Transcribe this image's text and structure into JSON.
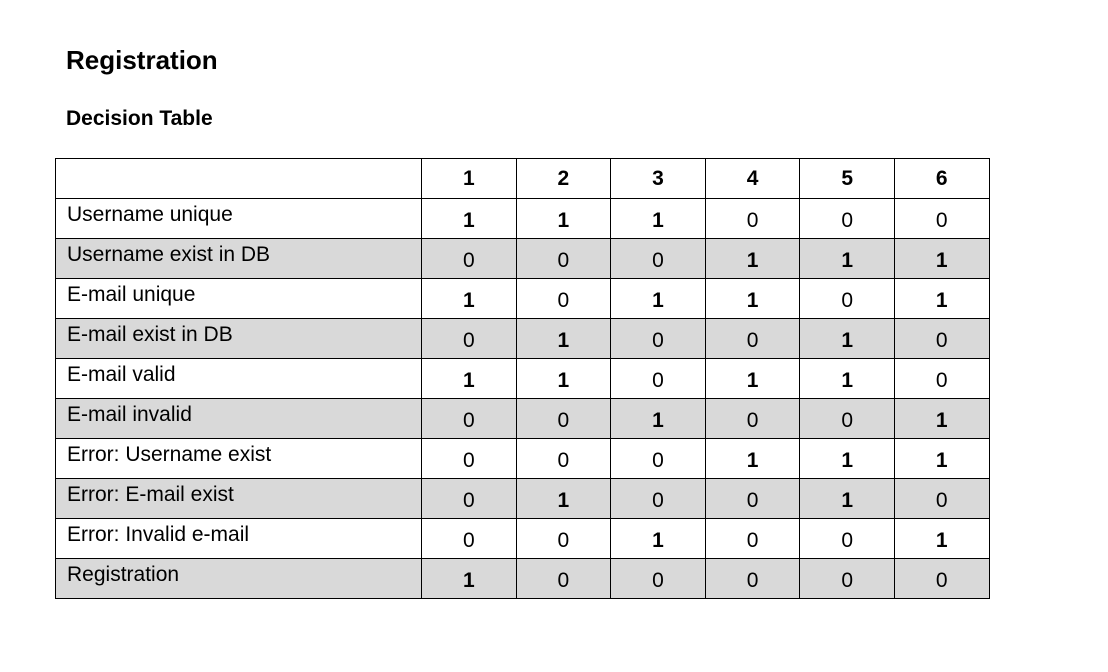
{
  "document": {
    "title": "Registration",
    "section": "Decision Table"
  },
  "table": {
    "columns": [
      "1",
      "2",
      "3",
      "4",
      "5",
      "6"
    ],
    "rows": [
      {
        "label": "Username unique",
        "values": [
          "1",
          "1",
          "1",
          "0",
          "0",
          "0"
        ],
        "shaded": false
      },
      {
        "label": "Username exist in DB",
        "values": [
          "0",
          "0",
          "0",
          "1",
          "1",
          "1"
        ],
        "shaded": true
      },
      {
        "label": "E-mail unique",
        "values": [
          "1",
          "0",
          "1",
          "1",
          "0",
          "1"
        ],
        "shaded": false
      },
      {
        "label": "E-mail exist in DB",
        "values": [
          "0",
          "1",
          "0",
          "0",
          "1",
          "0"
        ],
        "shaded": true
      },
      {
        "label": "E-mail valid",
        "values": [
          "1",
          "1",
          "0",
          "1",
          "1",
          "0"
        ],
        "shaded": false
      },
      {
        "label": "E-mail invalid",
        "values": [
          "0",
          "0",
          "1",
          "0",
          "0",
          "1"
        ],
        "shaded": true
      },
      {
        "label": "Error: Username exist",
        "values": [
          "0",
          "0",
          "0",
          "1",
          "1",
          "1"
        ],
        "shaded": false
      },
      {
        "label": "Error: E-mail exist",
        "values": [
          "0",
          "1",
          "0",
          "0",
          "1",
          "0"
        ],
        "shaded": true
      },
      {
        "label": "Error: Invalid e-mail",
        "values": [
          "0",
          "0",
          "1",
          "0",
          "0",
          "1"
        ],
        "shaded": false
      },
      {
        "label": "Registration",
        "values": [
          "1",
          "0",
          "0",
          "0",
          "0",
          "0"
        ],
        "shaded": true
      }
    ],
    "shade_color": "#d9d9d9",
    "border_color": "#000000"
  }
}
